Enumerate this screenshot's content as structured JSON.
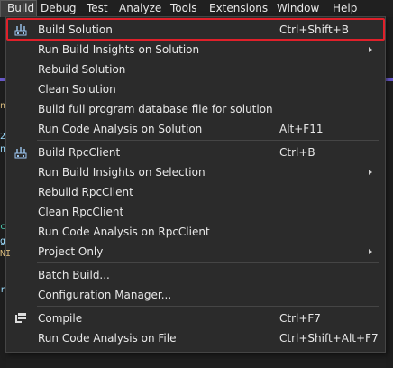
{
  "menubar": {
    "items": [
      "Build",
      "Debug",
      "Test",
      "Analyze",
      "Tools",
      "Extensions",
      "Window",
      "Help"
    ]
  },
  "editor": {
    "glyphs": [
      "n",
      "2",
      "n",
      "c",
      "g",
      "NI",
      "r"
    ]
  },
  "build_menu": {
    "groups": [
      [
        {
          "label": "Build Solution",
          "shortcut": "Ctrl+Shift+B",
          "icon": "build-icon",
          "highlighted": true
        },
        {
          "label": "Run Build Insights on Solution",
          "shortcut": "",
          "submenu": true
        },
        {
          "label": "Rebuild Solution",
          "shortcut": ""
        },
        {
          "label": "Clean Solution",
          "shortcut": ""
        },
        {
          "label": "Build full program database file for solution",
          "shortcut": ""
        },
        {
          "label": "Run Code Analysis on Solution",
          "shortcut": "Alt+F11"
        }
      ],
      [
        {
          "label": "Build RpcClient",
          "shortcut": "Ctrl+B",
          "icon": "build-icon"
        },
        {
          "label": "Run Build Insights on Selection",
          "shortcut": "",
          "submenu": true
        },
        {
          "label": "Rebuild RpcClient",
          "shortcut": ""
        },
        {
          "label": "Clean RpcClient",
          "shortcut": ""
        },
        {
          "label": "Run Code Analysis on RpcClient",
          "shortcut": ""
        },
        {
          "label": "Project Only",
          "shortcut": "",
          "submenu": true
        }
      ],
      [
        {
          "label": "Batch Build...",
          "shortcut": ""
        },
        {
          "label": "Configuration Manager...",
          "shortcut": ""
        }
      ],
      [
        {
          "label": "Compile",
          "shortcut": "Ctrl+F7",
          "icon": "compile-icon"
        },
        {
          "label": "Run Code Analysis on File",
          "shortcut": "Ctrl+Shift+Alt+F7"
        }
      ]
    ]
  },
  "colors": {
    "menu_bg": "#2b2b2b",
    "highlight_border": "#e0202a",
    "accent_band": "#6a5acd",
    "icon_blue": "#9cc6f0"
  }
}
